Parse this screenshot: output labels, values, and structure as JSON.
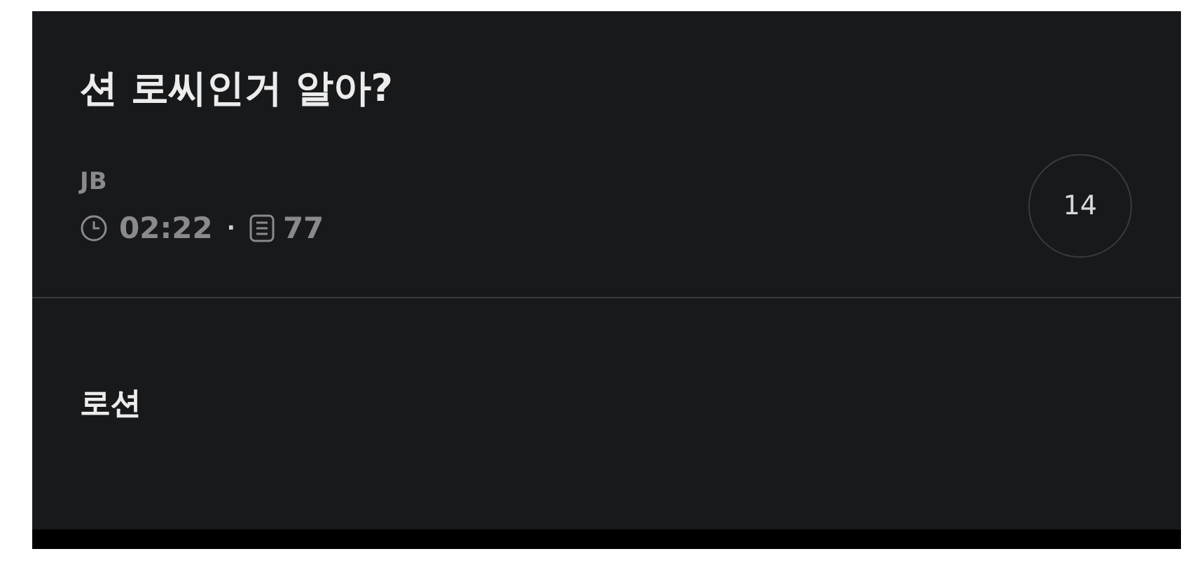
{
  "post": {
    "title": "션 로씨인거 알아?",
    "author": "JB",
    "time": "02:22",
    "separator": "·",
    "views": "77",
    "comment_count": "14"
  },
  "body": {
    "text": "로션"
  }
}
